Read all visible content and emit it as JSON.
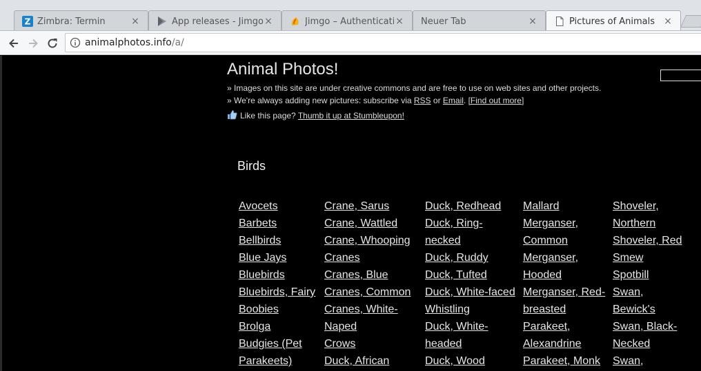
{
  "browser": {
    "tabs": [
      {
        "title": "Zimbra: Termin",
        "icon": "zimbra-icon",
        "active": false
      },
      {
        "title": "App releases - Jimgo",
        "icon": "play-store-icon",
        "active": false
      },
      {
        "title": "Jimgo – Authenticati",
        "icon": "jimgo-icon",
        "active": false
      },
      {
        "title": "Neuer Tab",
        "icon": "none",
        "active": false
      },
      {
        "title": "Pictures of Animals",
        "icon": "page-icon",
        "active": true
      }
    ],
    "close_glyph": "×",
    "url_host": "animalphotos.info",
    "url_path": "/a/"
  },
  "page": {
    "title": "Animal Photos!",
    "line1": "» Images on this site are under creative commons and are free to use on web sites and other projects.",
    "line2_prefix": "» We're always adding new pictures: subscribe via ",
    "line2_rss": "RSS",
    "line2_or": " or ",
    "line2_email": "Email",
    "line2_dot": ". ",
    "line2_more": "[Find out more]",
    "line3_prefix": "Like this page? ",
    "line3_link": "Thumb it up at Stumbleupon!",
    "section_title": "Birds",
    "columns": [
      [
        "Avocets",
        "Barbets",
        "Bellbirds",
        "Blue Jays",
        "Bluebirds",
        "Bluebirds, Fairy",
        "Boobies",
        "Brolga",
        "Budgies (Pet",
        "Parakeets)"
      ],
      [
        "Crane, Sarus",
        "Crane, Wattled",
        "Crane, Whooping",
        "Cranes",
        "Cranes, Blue",
        "Cranes, Common",
        "Cranes, White-",
        "Naped",
        "Crows",
        "Duck, African"
      ],
      [
        "Duck, Redhead",
        "Duck, Ring-",
        "necked",
        "Duck, Ruddy",
        "Duck, Tufted",
        "Duck, White-faced",
        "Whistling",
        "Duck, White-",
        "headed",
        "Duck, Wood"
      ],
      [
        "Mallard",
        "Merganser,",
        "Common",
        "Merganser,",
        "Hooded",
        "Merganser, Red-",
        "breasted",
        "Parakeet,",
        "Alexandrine",
        "Parakeet, Monk"
      ],
      [
        "Shoveler,",
        "Northern",
        "Shoveler, Red",
        "Smew",
        "Spotbill",
        "Swan,",
        "Bewick's",
        "Swan, Black-",
        "Necked",
        "Swan,"
      ]
    ]
  }
}
